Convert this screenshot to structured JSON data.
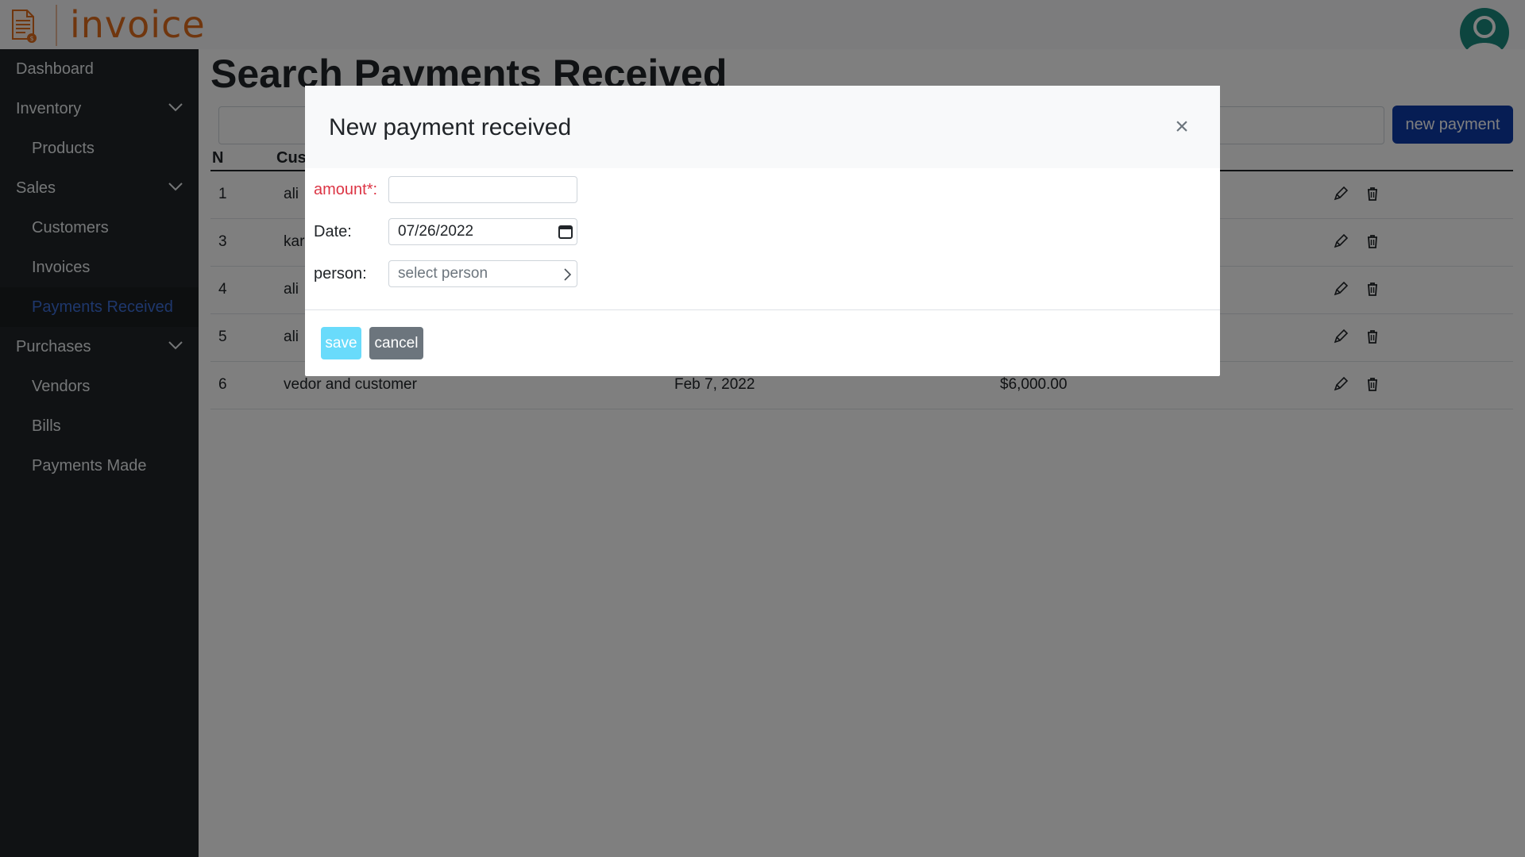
{
  "app": {
    "name": "invoice"
  },
  "sidebar": {
    "items": [
      {
        "label": "Dashboard",
        "level": 1,
        "expandable": false,
        "active": false
      },
      {
        "label": "Inventory",
        "level": 1,
        "expandable": true,
        "active": false
      },
      {
        "label": "Products",
        "level": 2,
        "expandable": false,
        "active": false
      },
      {
        "label": "Sales",
        "level": 1,
        "expandable": true,
        "active": false
      },
      {
        "label": "Customers",
        "level": 2,
        "expandable": false,
        "active": false
      },
      {
        "label": "Invoices",
        "level": 2,
        "expandable": false,
        "active": false
      },
      {
        "label": "Payments Received",
        "level": 2,
        "expandable": false,
        "active": true
      },
      {
        "label": "Purchases",
        "level": 1,
        "expandable": true,
        "active": false
      },
      {
        "label": "Vendors",
        "level": 2,
        "expandable": false,
        "active": false
      },
      {
        "label": "Bills",
        "level": 2,
        "expandable": false,
        "active": false
      },
      {
        "label": "Payments Made",
        "level": 2,
        "expandable": false,
        "active": false
      }
    ]
  },
  "main": {
    "title": "Search Payments Received",
    "new_button": "new payment",
    "table": {
      "headers": {
        "n": "N",
        "customer": "Cust"
      },
      "rows": [
        {
          "n": "1",
          "customer": "ali",
          "date": "",
          "amount": ""
        },
        {
          "n": "3",
          "customer": "kar",
          "date": "",
          "amount": ""
        },
        {
          "n": "4",
          "customer": "ali",
          "date": "",
          "amount": ""
        },
        {
          "n": "5",
          "customer": "ali",
          "date": "",
          "amount": ""
        },
        {
          "n": "6",
          "customer": "vedor and customer",
          "date": "Feb 7, 2022",
          "amount": "$6,000.00"
        }
      ]
    }
  },
  "modal": {
    "title": "New payment received",
    "close": "×",
    "fields": {
      "amount": {
        "label": "amount*:",
        "value": ""
      },
      "date": {
        "label": "Date:",
        "value": "07/26/2022"
      },
      "person": {
        "label": "person:",
        "placeholder": "select person"
      }
    },
    "save": "save",
    "cancel": "cancel"
  },
  "colors": {
    "brand": "#e06c1c",
    "sidebar_bg": "#212529",
    "active_link": "#3d6fd8",
    "primary_button": "#0d3ba8",
    "save_button": "#61dafb",
    "cancel_button": "#6c757d",
    "required_label": "#dc3545",
    "avatar": "#1a8a7e"
  }
}
